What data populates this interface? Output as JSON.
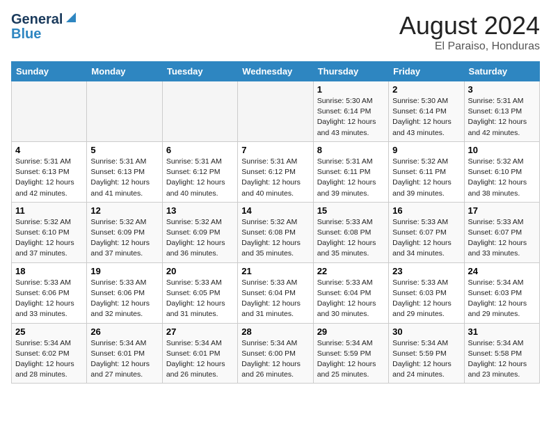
{
  "header": {
    "logo_general": "General",
    "logo_blue": "Blue",
    "month_title": "August 2024",
    "location": "El Paraiso, Honduras"
  },
  "weekdays": [
    "Sunday",
    "Monday",
    "Tuesday",
    "Wednesday",
    "Thursday",
    "Friday",
    "Saturday"
  ],
  "weeks": [
    [
      {
        "day": "",
        "info": ""
      },
      {
        "day": "",
        "info": ""
      },
      {
        "day": "",
        "info": ""
      },
      {
        "day": "",
        "info": ""
      },
      {
        "day": "1",
        "info": "Sunrise: 5:30 AM\nSunset: 6:14 PM\nDaylight: 12 hours\nand 43 minutes."
      },
      {
        "day": "2",
        "info": "Sunrise: 5:30 AM\nSunset: 6:14 PM\nDaylight: 12 hours\nand 43 minutes."
      },
      {
        "day": "3",
        "info": "Sunrise: 5:31 AM\nSunset: 6:13 PM\nDaylight: 12 hours\nand 42 minutes."
      }
    ],
    [
      {
        "day": "4",
        "info": "Sunrise: 5:31 AM\nSunset: 6:13 PM\nDaylight: 12 hours\nand 42 minutes."
      },
      {
        "day": "5",
        "info": "Sunrise: 5:31 AM\nSunset: 6:13 PM\nDaylight: 12 hours\nand 41 minutes."
      },
      {
        "day": "6",
        "info": "Sunrise: 5:31 AM\nSunset: 6:12 PM\nDaylight: 12 hours\nand 40 minutes."
      },
      {
        "day": "7",
        "info": "Sunrise: 5:31 AM\nSunset: 6:12 PM\nDaylight: 12 hours\nand 40 minutes."
      },
      {
        "day": "8",
        "info": "Sunrise: 5:31 AM\nSunset: 6:11 PM\nDaylight: 12 hours\nand 39 minutes."
      },
      {
        "day": "9",
        "info": "Sunrise: 5:32 AM\nSunset: 6:11 PM\nDaylight: 12 hours\nand 39 minutes."
      },
      {
        "day": "10",
        "info": "Sunrise: 5:32 AM\nSunset: 6:10 PM\nDaylight: 12 hours\nand 38 minutes."
      }
    ],
    [
      {
        "day": "11",
        "info": "Sunrise: 5:32 AM\nSunset: 6:10 PM\nDaylight: 12 hours\nand 37 minutes."
      },
      {
        "day": "12",
        "info": "Sunrise: 5:32 AM\nSunset: 6:09 PM\nDaylight: 12 hours\nand 37 minutes."
      },
      {
        "day": "13",
        "info": "Sunrise: 5:32 AM\nSunset: 6:09 PM\nDaylight: 12 hours\nand 36 minutes."
      },
      {
        "day": "14",
        "info": "Sunrise: 5:32 AM\nSunset: 6:08 PM\nDaylight: 12 hours\nand 35 minutes."
      },
      {
        "day": "15",
        "info": "Sunrise: 5:33 AM\nSunset: 6:08 PM\nDaylight: 12 hours\nand 35 minutes."
      },
      {
        "day": "16",
        "info": "Sunrise: 5:33 AM\nSunset: 6:07 PM\nDaylight: 12 hours\nand 34 minutes."
      },
      {
        "day": "17",
        "info": "Sunrise: 5:33 AM\nSunset: 6:07 PM\nDaylight: 12 hours\nand 33 minutes."
      }
    ],
    [
      {
        "day": "18",
        "info": "Sunrise: 5:33 AM\nSunset: 6:06 PM\nDaylight: 12 hours\nand 33 minutes."
      },
      {
        "day": "19",
        "info": "Sunrise: 5:33 AM\nSunset: 6:06 PM\nDaylight: 12 hours\nand 32 minutes."
      },
      {
        "day": "20",
        "info": "Sunrise: 5:33 AM\nSunset: 6:05 PM\nDaylight: 12 hours\nand 31 minutes."
      },
      {
        "day": "21",
        "info": "Sunrise: 5:33 AM\nSunset: 6:04 PM\nDaylight: 12 hours\nand 31 minutes."
      },
      {
        "day": "22",
        "info": "Sunrise: 5:33 AM\nSunset: 6:04 PM\nDaylight: 12 hours\nand 30 minutes."
      },
      {
        "day": "23",
        "info": "Sunrise: 5:33 AM\nSunset: 6:03 PM\nDaylight: 12 hours\nand 29 minutes."
      },
      {
        "day": "24",
        "info": "Sunrise: 5:34 AM\nSunset: 6:03 PM\nDaylight: 12 hours\nand 29 minutes."
      }
    ],
    [
      {
        "day": "25",
        "info": "Sunrise: 5:34 AM\nSunset: 6:02 PM\nDaylight: 12 hours\nand 28 minutes."
      },
      {
        "day": "26",
        "info": "Sunrise: 5:34 AM\nSunset: 6:01 PM\nDaylight: 12 hours\nand 27 minutes."
      },
      {
        "day": "27",
        "info": "Sunrise: 5:34 AM\nSunset: 6:01 PM\nDaylight: 12 hours\nand 26 minutes."
      },
      {
        "day": "28",
        "info": "Sunrise: 5:34 AM\nSunset: 6:00 PM\nDaylight: 12 hours\nand 26 minutes."
      },
      {
        "day": "29",
        "info": "Sunrise: 5:34 AM\nSunset: 5:59 PM\nDaylight: 12 hours\nand 25 minutes."
      },
      {
        "day": "30",
        "info": "Sunrise: 5:34 AM\nSunset: 5:59 PM\nDaylight: 12 hours\nand 24 minutes."
      },
      {
        "day": "31",
        "info": "Sunrise: 5:34 AM\nSunset: 5:58 PM\nDaylight: 12 hours\nand 23 minutes."
      }
    ]
  ]
}
